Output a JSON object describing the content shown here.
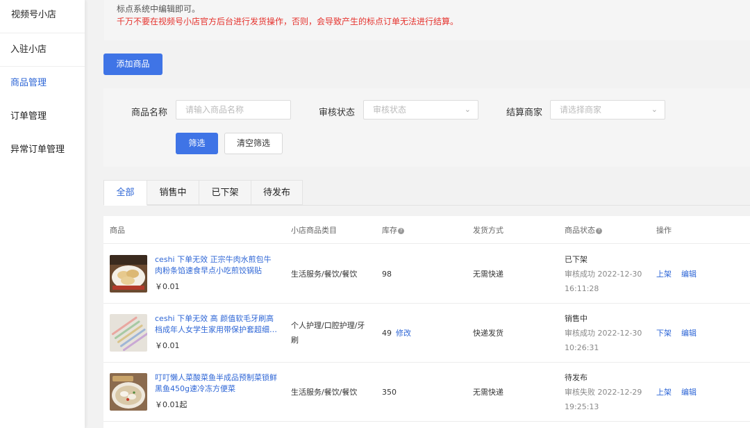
{
  "sidebar": {
    "title": "视频号小店",
    "items": [
      {
        "label": "入驻小店",
        "active": false
      },
      {
        "label": "商品管理",
        "active": true
      },
      {
        "label": "订单管理",
        "active": false
      },
      {
        "label": "异常订单管理",
        "active": false
      }
    ]
  },
  "notice": {
    "line1": "标点系统中编辑即可。",
    "line2": "千万不要在视频号小店官方后台进行发货操作，否则，会导致产生的标点订单无法进行结算。"
  },
  "toolbar": {
    "add_label": "添加商品"
  },
  "filter": {
    "name_label": "商品名称",
    "name_placeholder": "请输入商品名称",
    "audit_label": "审核状态",
    "audit_placeholder": "审核状态",
    "merchant_label": "结算商家",
    "merchant_placeholder": "请选择商家",
    "filter_button": "筛选",
    "clear_button": "清空筛选"
  },
  "tabs": [
    "全部",
    "销售中",
    "已下架",
    "待发布"
  ],
  "table": {
    "headers": {
      "product": "商品",
      "category": "小店商品类目",
      "stock": "库存",
      "shipping": "发货方式",
      "status": "商品状态",
      "ops": "操作"
    },
    "rows": [
      {
        "name": "ceshi 下单无效 正宗牛肉水煎包牛肉粉条馅速食早点小吃煎饺锅贴",
        "price": "￥0.01",
        "category": "生活服务/餐饮/餐饮",
        "stock": "98",
        "stock_action": "",
        "shipping": "无需快递",
        "status": "已下架",
        "audit": "审核成功 2022-12-30 16:11:28",
        "op1": "上架",
        "op2": "编辑",
        "thumb": "food-dumplings-icon"
      },
      {
        "name": "ceshi 下单无效 高 颜值软毛牙刷高档成年人女学生家用带保护套超细软...",
        "price": "￥0.01",
        "category": "个人护理/口腔护理/牙刷",
        "stock": "49",
        "stock_action": "修改",
        "shipping": "快递发货",
        "status": "销售中",
        "audit": "审核成功 2022-12-30 10:26:31",
        "op1": "下架",
        "op2": "编辑",
        "thumb": "toothbrush-icon"
      },
      {
        "name": "叮叮懒人菜酸菜鱼半成品预制菜锁鲜黑鱼450g速冷冻方便菜",
        "price": "￥0.01起",
        "category": "生活服务/餐饮/餐饮",
        "stock": "350",
        "stock_action": "",
        "shipping": "无需快递",
        "status": "待发布",
        "audit": "审核失败 2022-12-29 19:25:13",
        "op1": "上架",
        "op2": "编辑",
        "thumb": "fish-dish-icon"
      }
    ]
  },
  "colors": {
    "accent": "#3f74e6",
    "link": "#2e66d6",
    "warning": "#e5322d"
  }
}
